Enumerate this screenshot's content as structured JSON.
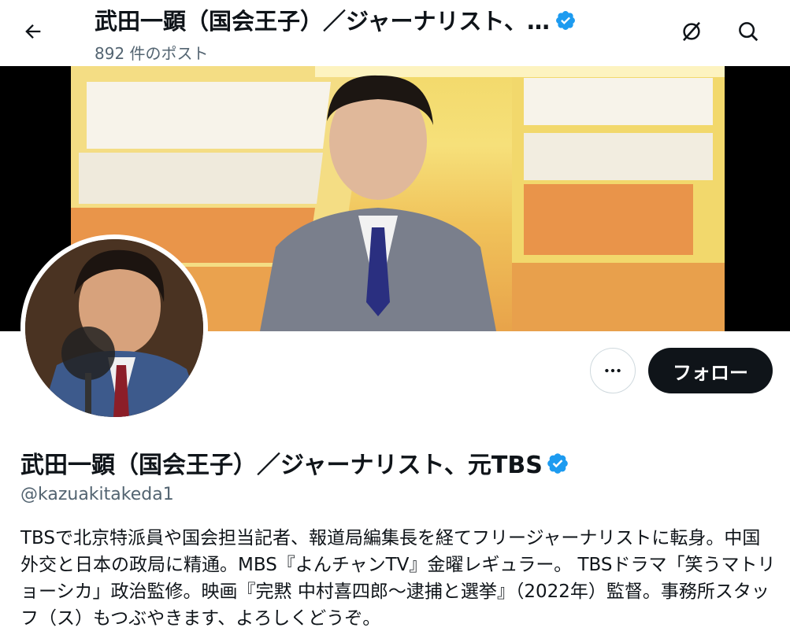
{
  "header": {
    "title": "武田一顕（国会王子）／ジャーナリスト、…",
    "post_count": "892 件のポスト",
    "back_icon": "arrow-left-icon",
    "hide_icon": "no-symbol-icon",
    "search_icon": "search-icon"
  },
  "profile": {
    "name": "武田一顕（国会王子）／ジャーナリスト、元TBS",
    "handle": "@kazuakitakeda1",
    "bio": "TBSで北京特派員や国会担当記者、報道局編集長を経てフリージャーナリストに転身。中国外交と日本の政局に精通。MBS『よんチャンTV』金曜レギュラー。 TBSドラマ「笑うマトリョーシカ」政治監修。映画『完黙 中村喜四郎〜逮捕と選挙』（2022年）監督。事務所スタッフ（ス）もつぶやきます、よろしくどうぞ。",
    "follow_label": "フォロー",
    "more_icon": "more-horizontal-icon",
    "verified_icon": "verified-badge-icon"
  },
  "colors": {
    "verified": "#1d9bf0",
    "text_primary": "#0f1419",
    "text_secondary": "#536471",
    "follow_bg": "#0f1419"
  }
}
